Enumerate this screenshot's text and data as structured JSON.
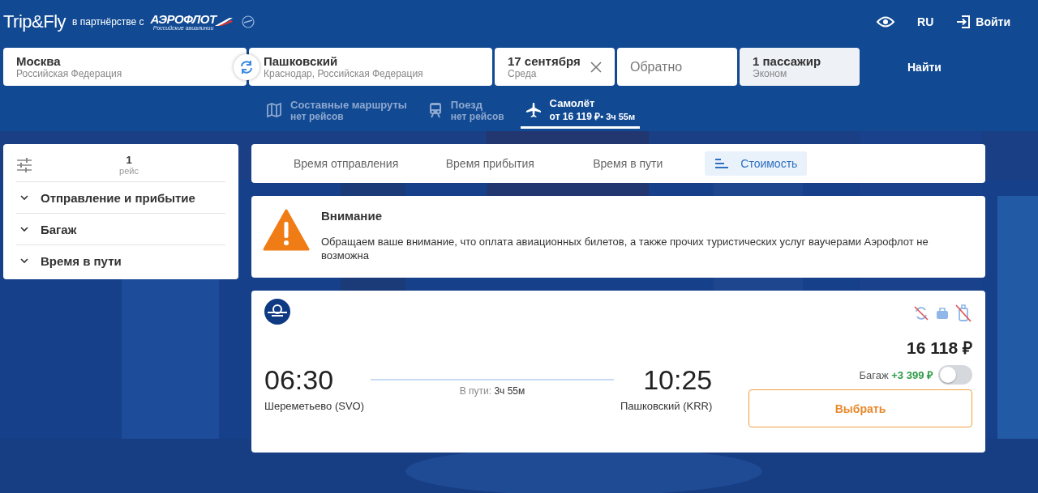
{
  "logo": {
    "brand": "Trip&Fly",
    "partner_text": "в партнёрстве с",
    "partner": "АЭРОФЛОТ",
    "partner_sub": "Российские авиалинии"
  },
  "header": {
    "language": "RU",
    "login": "Войти"
  },
  "search": {
    "from": {
      "city": "Москва",
      "country": "Российская Федерация"
    },
    "to": {
      "city": "Пашковский",
      "country": "Краснодар, Российская Федерация"
    },
    "date": {
      "value": "17 сентября",
      "weekday": "Среда"
    },
    "return": {
      "placeholder": "Обратно"
    },
    "passengers": {
      "value": "1 пассажир",
      "class": "Эконом"
    },
    "button": "Найти"
  },
  "modes": [
    {
      "kind": "map",
      "title": "Составные маршруты",
      "subtitle": "нет рейсов",
      "selected": false
    },
    {
      "kind": "train",
      "title": "Поезд",
      "subtitle": "нет рейсов",
      "selected": false
    },
    {
      "kind": "plane",
      "title": "Самолёт",
      "subtitle": "от 16 119 ₽",
      "duration": "• 3ч 55м",
      "selected": true
    }
  ],
  "filters": {
    "count": "1",
    "count_label": "рейс",
    "sections": [
      {
        "label": "Отправление и прибытие",
        "expanded": false
      },
      {
        "label": "Багаж",
        "expanded": false
      },
      {
        "label": "Время в пути",
        "expanded": false
      }
    ]
  },
  "sort_tabs": [
    {
      "label": "Время отправления",
      "selected": false
    },
    {
      "label": "Время прибытия",
      "selected": false
    },
    {
      "label": "Время в пути",
      "selected": false
    },
    {
      "label": "Стоимость",
      "selected": true
    }
  ],
  "alert": {
    "title": "Внимание",
    "text": "Обращаем ваше внимание, что оплата авиационных билетов, а также прочих туристических услуг ваучерами Аэрофлот не возможна"
  },
  "flight": {
    "departure_time": "06:30",
    "departure_airport": "Шереметьево (SVO)",
    "arrival_time": "10:25",
    "arrival_airport": "Пашковский (KRR)",
    "duration_label": "В пути:",
    "duration": "3ч 55м",
    "price": "16 118 ₽",
    "baggage_label": "Багаж",
    "baggage_price": "+3 399 ₽",
    "baggage_on": false,
    "button": "Выбрать"
  }
}
